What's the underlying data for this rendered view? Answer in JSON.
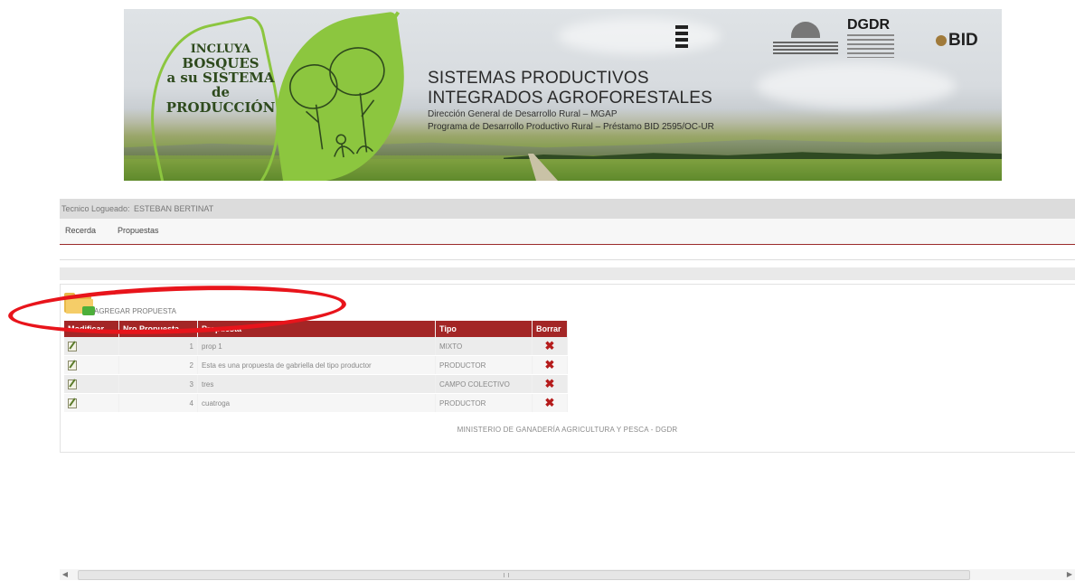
{
  "banner": {
    "slogan": {
      "line1": "INCLUYA",
      "line2": "BOSQUES",
      "line3": "a su SISTEMA",
      "line4": "de PRODUCCIÓN"
    },
    "title_line1": "SISTEMAS PRODUCTIVOS",
    "title_line2": "INTEGRADOS AGROFORESTALES",
    "subtitle1": "Dirección General de Desarrollo Rural – MGAP",
    "subtitle2": "Programa de Desarrollo Productivo Rural – Préstamo BID 2595/OC-UR",
    "logo_dgdr": "DGDR",
    "logo_bid": "BID"
  },
  "header": {
    "logged_label": "Tecnico Logueado:",
    "logged_user": "ESTEBAN BERTINAT"
  },
  "menu": {
    "items": [
      {
        "label": "Recerda"
      },
      {
        "label": "Propuestas"
      }
    ]
  },
  "actions": {
    "add_proposal_label": "AGREGAR PROPUESTA"
  },
  "table": {
    "headers": {
      "modificar": "Modificar",
      "nro": "Nro Propuesta",
      "propuesta": "Propuesta",
      "tipo": "Tipo",
      "borrar": "Borrar"
    },
    "rows": [
      {
        "nro": "1",
        "propuesta": "prop 1",
        "tipo": "MIXTO"
      },
      {
        "nro": "2",
        "propuesta": "Esta es una propuesta de gabriella del tipo productor",
        "tipo": "PRODUCTOR"
      },
      {
        "nro": "3",
        "propuesta": "tres",
        "tipo": "CAMPO COLECTIVO"
      },
      {
        "nro": "4",
        "propuesta": "cuatroga",
        "tipo": "PRODUCTOR"
      }
    ]
  },
  "footer": {
    "text": "MINISTERIO DE GANADERÍA AGRICULTURA Y PESCA - DGDR"
  },
  "icons": {
    "add": "folder-add-icon",
    "edit": "edit-icon",
    "delete": "delete-icon"
  },
  "colors": {
    "table_header": "#a32626",
    "delete_icon": "#b51b1b",
    "annotation_ellipse": "#e8141b",
    "leaf_green": "#8cc63f"
  }
}
